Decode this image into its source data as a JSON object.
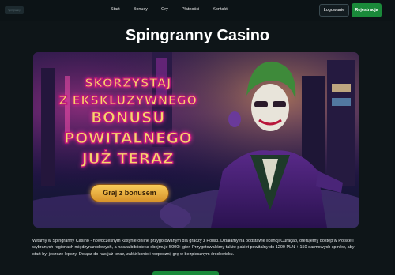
{
  "header": {
    "logo_text": "Spingranny",
    "nav": [
      "Start",
      "Bonusy",
      "Gry",
      "Płatności",
      "Kontakt"
    ],
    "login_label": "Logowanie",
    "register_label": "Rejestracja"
  },
  "page_title": "Spingranny Casino",
  "banner": {
    "promo_lines": [
      "SKORZYSTAJ",
      "Z EKSKLUZYWNEGO",
      "BONUSU",
      "POWITALNEGO",
      "JUŻ TERAZ"
    ],
    "cta_label": "Graj z bonusem"
  },
  "intro_text": "Witamy w Spingranny Casino - nowoczesnym kasynie online przygotowanym dla graczy z Polski. Działamy na podstawie licencji Curaçao, oferujemy dostęp w Polsce i wybranych regionach międzynarodowych, a nasza biblioteka obejmuje 5000+ gier. Przygotowaliśmy także pakiet powitalny do 1200 PLN + 150 darmowych spinów, aby start był jeszcze lepszy. Dołącz do nas już teraz, załóż konto i rozpocznij grę w bezpiecznym środowisku.",
  "colors": {
    "background": "#0e1518",
    "register_button": "#1a8a3a",
    "promo_text": "#f6d66c",
    "promo_stroke": "#c0187b",
    "cta": "#e5ad41"
  }
}
